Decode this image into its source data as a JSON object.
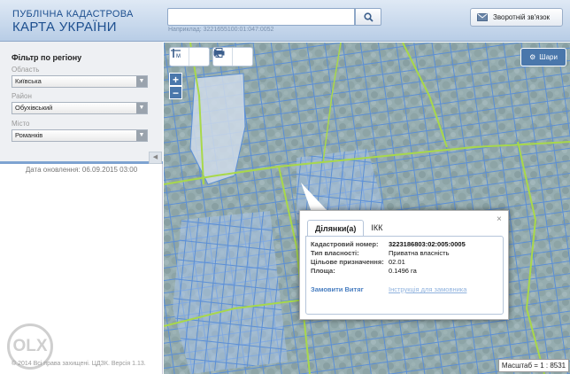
{
  "header": {
    "logo_line1": "ПУБЛІЧНА КАДАСТРОВА",
    "logo_line2": "КАРТА УКРАЇНИ",
    "search_value": "",
    "search_hint": "Наприклад: 3221655100:01:047:0052",
    "feedback_label": "Зворотній зв'язок"
  },
  "sidebar": {
    "filter_title": "Фільтр по регіону",
    "region_label": "Область",
    "region_value": "Київська",
    "district_label": "Район",
    "district_value": "Обухівський",
    "city_label": "Місто",
    "city_value": "Романків",
    "update_date": "Дата оновлення: 06.09.2015 03:00",
    "copyright": "© 2014 Всі права захищені. ЦДЗК. Версія 1.13.",
    "watermark": "OLX"
  },
  "map": {
    "layers_label": "Шари",
    "zoom_in": "+",
    "zoom_out": "−",
    "scale": "Масштаб = 1 : 8531",
    "tools": {
      "measure_line": "M",
      "measure_area": "M",
      "print": "print-icon",
      "identify": "identify-icon"
    }
  },
  "popup": {
    "tab_parcels": "Ділянки(а)",
    "tab_ikk": "ІКК",
    "close": "×",
    "cadastral_label": "Кадастровий номер:",
    "cadastral_value": "3223186803:02:005:0005",
    "ownership_label": "Тип власності:",
    "ownership_value": "Приватна власність",
    "purpose_label": "Цільове призначення:",
    "purpose_value": "02.01",
    "area_label": "Площа:",
    "area_value": "0.1496 га",
    "order_link": "Замовити Витяг",
    "instruction_link": "Інструкція для замовника"
  },
  "colors": {
    "header_text": "#1d4f8f",
    "button_blue": "#4a77ab",
    "parcel_fill": "#a9c6ec",
    "parcel_stroke": "#5b8fd6",
    "road": "#a8d84a",
    "link": "#4a7fc1"
  }
}
